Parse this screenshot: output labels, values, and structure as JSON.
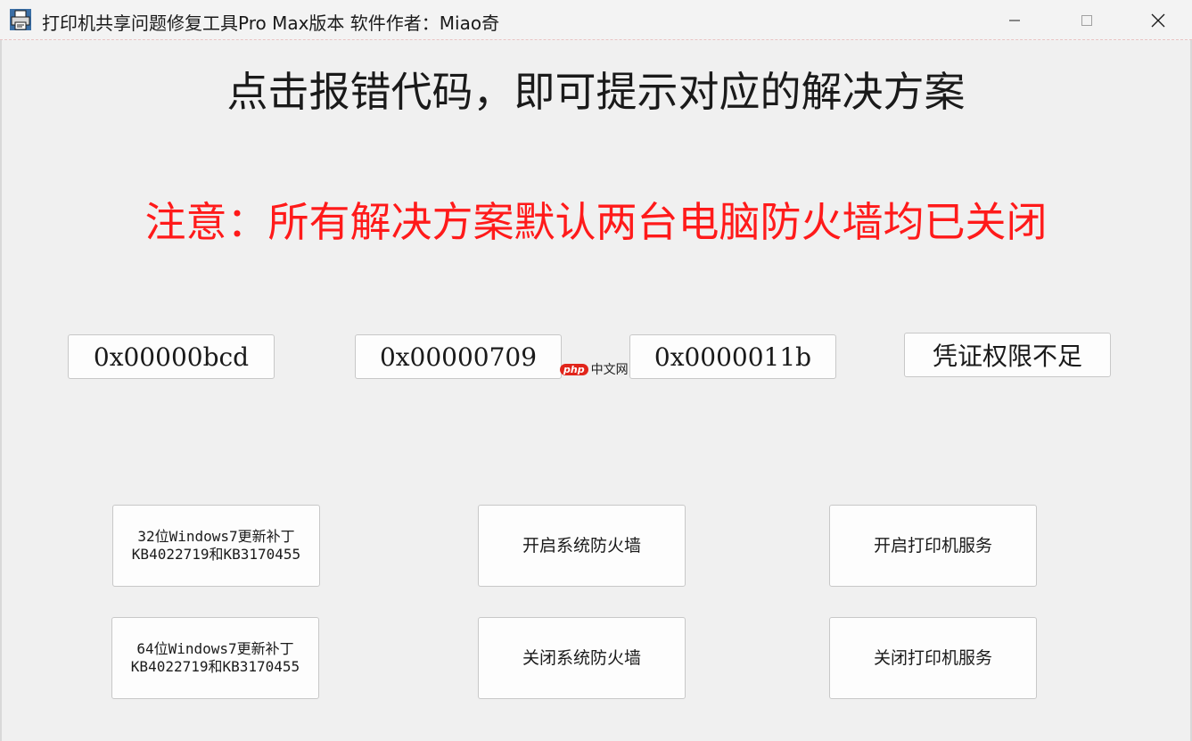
{
  "window": {
    "title": "打印机共享问题修复工具Pro Max版本  软件作者：Miao奇",
    "controls": {
      "minimize_icon": "minimize-icon",
      "maximize_icon": "maximize-icon",
      "close_icon": "close-icon"
    },
    "app_icon": "printer-icon"
  },
  "main": {
    "heading": "点击报错代码，即可提示对应的解决方案",
    "notice": "注意：所有解决方案默认两台电脑防火墙均已关闭",
    "notice_color": "#ff1a1a",
    "error_codes": [
      {
        "label": "0x00000bcd"
      },
      {
        "label": "0x00000709"
      },
      {
        "label": "0x0000011b"
      },
      {
        "label": "凭证权限不足"
      }
    ],
    "actions": {
      "patch32": {
        "line1": "32位Windows7更新补丁",
        "line2": "KB4022719和KB3170455"
      },
      "patch64": {
        "line1": "64位Windows7更新补丁",
        "line2": "KB4022719和KB3170455"
      },
      "enable_firewall": "开启系统防火墙",
      "disable_firewall": "关闭系统防火墙",
      "enable_printer_service": "开启打印机服务",
      "disable_printer_service": "关闭打印机服务"
    }
  },
  "watermark": {
    "logo": "php",
    "text": "中文网"
  }
}
